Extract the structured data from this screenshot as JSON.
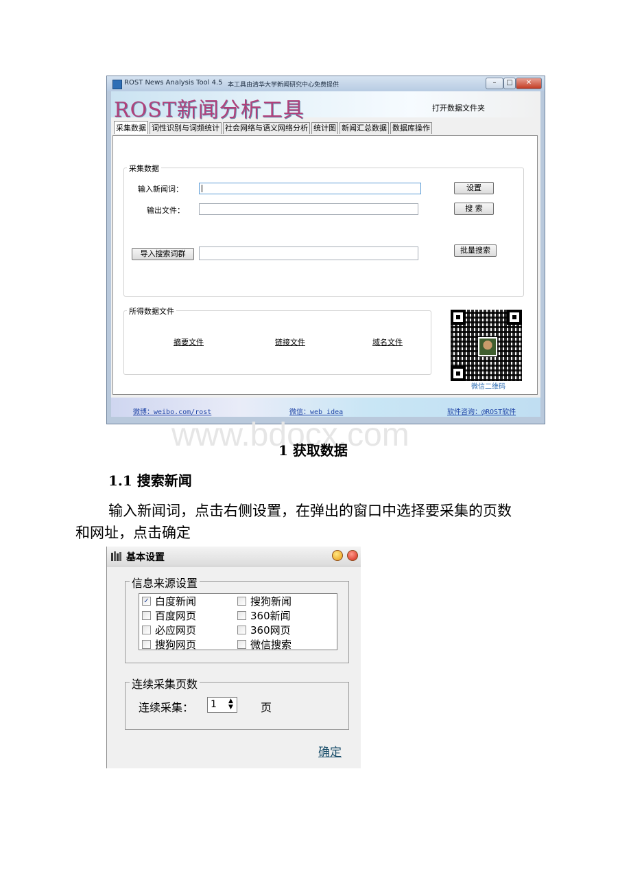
{
  "rost_window": {
    "title": "ROST News Analysis Tool 4.5",
    "subtitle": "本工具由清华大学新闻研究中心免费提供",
    "banner_title": "ROST新闻分析工具",
    "open_folder": "打开数据文件夹",
    "tabs": [
      "采集数据",
      "词性识别与词频统计",
      "社会网络与语义网络分析",
      "统计图",
      "新闻汇总数据",
      "数据库操作"
    ],
    "collect_group": {
      "legend": "采集数据",
      "news_word_label": "输入新闻词：",
      "output_file_label": "输出文件：",
      "settings_button": "设置",
      "search_button": "搜 索",
      "import_button": "导入搜索词群",
      "batch_button": "批量搜索"
    },
    "files_group": {
      "legend": "所得数据文件",
      "links": [
        "摘要文件",
        "链接文件",
        "域名文件"
      ]
    },
    "qr_label": "微信二维码",
    "footer": {
      "weibo": "微博：weibo.com/rost",
      "wechat": "微信：web idea",
      "consult": "软件咨询：@ROST软件"
    }
  },
  "watermark": "www.bdocx.com",
  "section_title": "1 获取数据",
  "subsection_title": "1.1 搜索新闻",
  "paragraph": {
    "line1": "输入新闻词，点击右侧设置，在弹出的窗口中选择要采集的页数",
    "line2": "和网址，点击确定"
  },
  "settings_dialog": {
    "title": "基本设置",
    "source_legend": "信息来源设置",
    "sources_left": [
      {
        "label": "白度新闻",
        "checked": true
      },
      {
        "label": "百度网页",
        "checked": false
      },
      {
        "label": "必应网页",
        "checked": false
      },
      {
        "label": "搜狗网页",
        "checked": false
      }
    ],
    "sources_right": [
      {
        "label": "搜狗新闻",
        "checked": false
      },
      {
        "label": "360新闻",
        "checked": false
      },
      {
        "label": "360网页",
        "checked": false
      },
      {
        "label": "微信搜索",
        "checked": false
      }
    ],
    "pages_legend": "连续采集页数",
    "pages_label": "连续采集：",
    "pages_value": "1",
    "pages_unit": "页",
    "ok_label": "确定"
  }
}
